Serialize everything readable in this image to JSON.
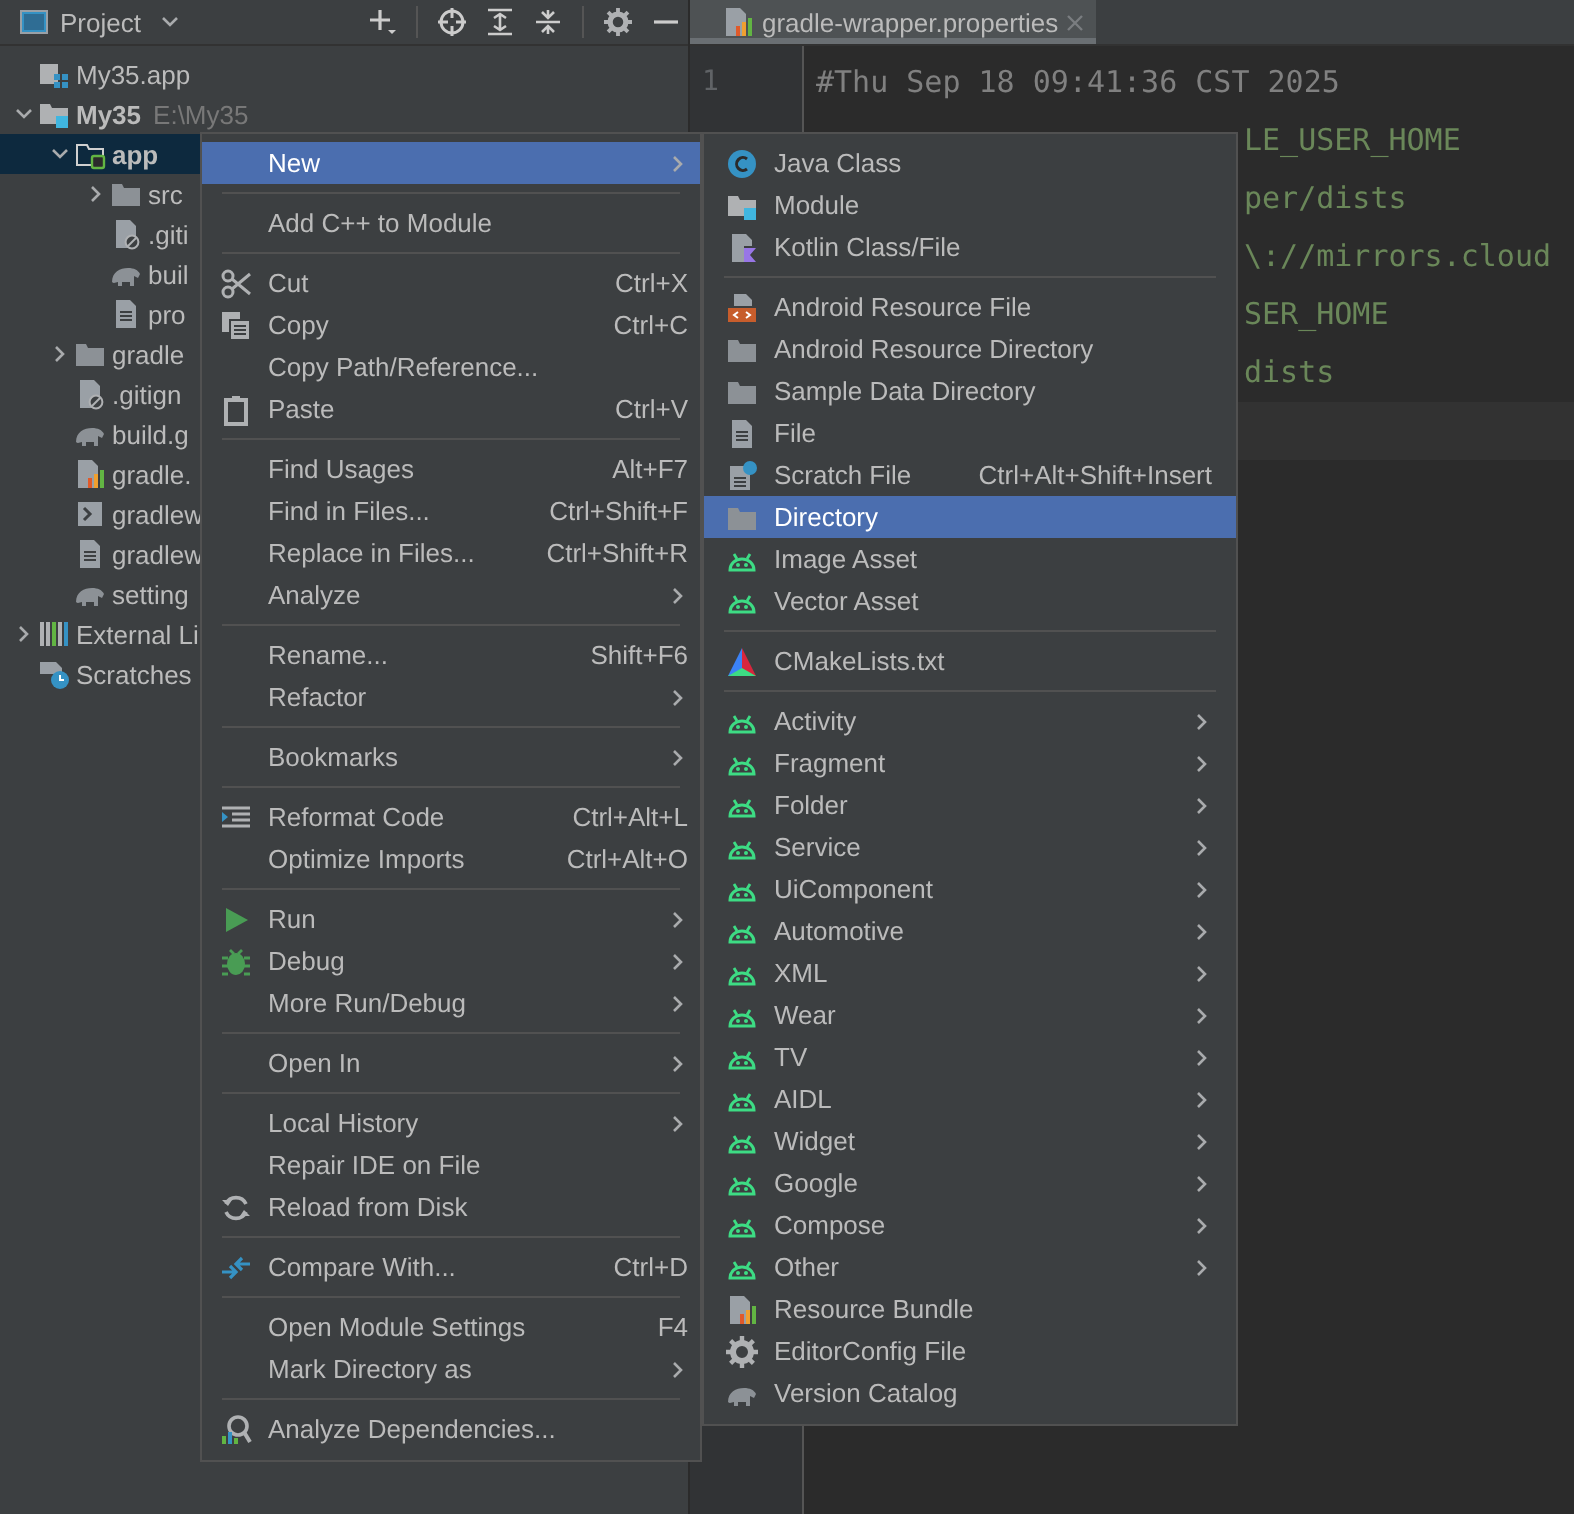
{
  "project_panel": {
    "title": "Project",
    "tree": [
      {
        "label": "My35.app",
        "kind": "module-app",
        "selected": false
      },
      {
        "label": "My35",
        "path": "E:\\My35",
        "kind": "module",
        "bold": true,
        "expanded": true,
        "selected": false,
        "children": [
          {
            "label": "app",
            "kind": "module-folder",
            "bold": true,
            "expanded": true,
            "selected": true,
            "children": [
              {
                "label": "src",
                "kind": "folder",
                "expanded": false,
                "selected": false
              },
              {
                "label": ".giti",
                "kind": "file-ignore",
                "selected": false
              },
              {
                "label": "buil",
                "kind": "elephant",
                "selected": false
              },
              {
                "label": "pro",
                "kind": "file",
                "selected": false
              }
            ]
          },
          {
            "label": "gradle",
            "kind": "folder",
            "expanded": false,
            "selected": false
          },
          {
            "label": ".gitign",
            "kind": "file-ignore",
            "selected": false
          },
          {
            "label": "build.g",
            "kind": "elephant",
            "selected": false
          },
          {
            "label": "gradle.",
            "kind": "bars",
            "selected": false
          },
          {
            "label": "gradlew",
            "kind": "terminal",
            "selected": false
          },
          {
            "label": "gradlew",
            "kind": "file",
            "selected": false
          },
          {
            "label": "setting",
            "kind": "elephant",
            "selected": false
          }
        ]
      },
      {
        "label": "External Li",
        "kind": "library",
        "expanded": false,
        "selected": false
      },
      {
        "label": "Scratches",
        "kind": "scratches",
        "selected": false
      }
    ]
  },
  "editor": {
    "tab": {
      "title": "gradle-wrapper.properties",
      "selected": true
    },
    "line_numbers": [
      "1"
    ],
    "lines": [
      {
        "text": "#Thu Sep 18 09:41:36 CST 2025",
        "kind": "comment"
      },
      {
        "text": "LE_USER_HOME",
        "kind": "clipped"
      },
      {
        "text": "per/dists",
        "kind": "clipped"
      },
      {
        "text": "\\://mirrors.cloud",
        "kind": "clipped"
      },
      {
        "text": "SER_HOME",
        "kind": "clipped"
      },
      {
        "text": "dists",
        "kind": "clipped"
      }
    ]
  },
  "context_menu": {
    "items": [
      {
        "kind": "plain",
        "label": "New",
        "submenu": true,
        "selected": true
      },
      {
        "kind": "separator"
      },
      {
        "kind": "plain",
        "label": "Add C++ to Module",
        "selected": false
      },
      {
        "kind": "separator"
      },
      {
        "kind": "scissors",
        "label": "Cut",
        "shortcut": "Ctrl+X",
        "selected": false
      },
      {
        "kind": "copy",
        "label": "Copy",
        "shortcut": "Ctrl+C",
        "selected": false
      },
      {
        "kind": "plain",
        "label": "Copy Path/Reference...",
        "selected": false
      },
      {
        "kind": "clipboard",
        "label": "Paste",
        "shortcut": "Ctrl+V",
        "selected": false
      },
      {
        "kind": "separator"
      },
      {
        "kind": "plain",
        "label": "Find Usages",
        "shortcut": "Alt+F7",
        "selected": false
      },
      {
        "kind": "plain",
        "label": "Find in Files...",
        "shortcut": "Ctrl+Shift+F",
        "selected": false
      },
      {
        "kind": "plain",
        "label": "Replace in Files...",
        "shortcut": "Ctrl+Shift+R",
        "selected": false
      },
      {
        "kind": "plain",
        "label": "Analyze",
        "submenu": true,
        "selected": false
      },
      {
        "kind": "separator"
      },
      {
        "kind": "plain",
        "label": "Rename...",
        "shortcut": "Shift+F6",
        "selected": false
      },
      {
        "kind": "plain",
        "label": "Refactor",
        "submenu": true,
        "selected": false
      },
      {
        "kind": "separator"
      },
      {
        "kind": "plain",
        "label": "Bookmarks",
        "submenu": true,
        "selected": false
      },
      {
        "kind": "separator"
      },
      {
        "kind": "reformat",
        "label": "Reformat Code",
        "shortcut": "Ctrl+Alt+L",
        "selected": false
      },
      {
        "kind": "plain",
        "label": "Optimize Imports",
        "shortcut": "Ctrl+Alt+O",
        "selected": false
      },
      {
        "kind": "separator"
      },
      {
        "kind": "play",
        "label": "Run",
        "submenu": true,
        "selected": false
      },
      {
        "kind": "bug",
        "label": "Debug",
        "submenu": true,
        "selected": false
      },
      {
        "kind": "plain",
        "label": "More Run/Debug",
        "submenu": true,
        "selected": false
      },
      {
        "kind": "separator"
      },
      {
        "kind": "plain",
        "label": "Open In",
        "submenu": true,
        "selected": false
      },
      {
        "kind": "separator"
      },
      {
        "kind": "plain",
        "label": "Local History",
        "submenu": true,
        "selected": false
      },
      {
        "kind": "plain",
        "label": "Repair IDE on File",
        "selected": false
      },
      {
        "kind": "reload",
        "label": "Reload from Disk",
        "selected": false
      },
      {
        "kind": "separator"
      },
      {
        "kind": "compare",
        "label": "Compare With...",
        "shortcut": "Ctrl+D",
        "selected": false
      },
      {
        "kind": "separator"
      },
      {
        "kind": "plain",
        "label": "Open Module Settings",
        "shortcut": "F4",
        "selected": false
      },
      {
        "kind": "plain",
        "label": "Mark Directory as",
        "submenu": true,
        "selected": false
      },
      {
        "kind": "separator"
      },
      {
        "kind": "analyze",
        "label": "Analyze Dependencies...",
        "selected": false
      }
    ]
  },
  "new_submenu": {
    "items": [
      {
        "kind": "java",
        "label": "Java Class",
        "selected": false
      },
      {
        "kind": "module",
        "label": "Module",
        "selected": false
      },
      {
        "kind": "kotlin",
        "label": "Kotlin Class/File",
        "selected": false
      },
      {
        "kind": "separator"
      },
      {
        "kind": "res-file",
        "label": "Android Resource File",
        "selected": false
      },
      {
        "kind": "folder",
        "label": "Android Resource Directory",
        "selected": false
      },
      {
        "kind": "folder",
        "label": "Sample Data Directory",
        "selected": false
      },
      {
        "kind": "file",
        "label": "File",
        "selected": false
      },
      {
        "kind": "scratch",
        "label": "Scratch File",
        "shortcut": "Ctrl+Alt+Shift+Insert",
        "selected": false
      },
      {
        "kind": "folder",
        "label": "Directory",
        "selected": true
      },
      {
        "kind": "android",
        "label": "Image Asset",
        "selected": false
      },
      {
        "kind": "android",
        "label": "Vector Asset",
        "selected": false
      },
      {
        "kind": "separator"
      },
      {
        "kind": "cmake",
        "label": "CMakeLists.txt",
        "selected": false
      },
      {
        "kind": "separator"
      },
      {
        "kind": "android",
        "label": "Activity",
        "submenu": true,
        "selected": false
      },
      {
        "kind": "android",
        "label": "Fragment",
        "submenu": true,
        "selected": false
      },
      {
        "kind": "android",
        "label": "Folder",
        "submenu": true,
        "selected": false
      },
      {
        "kind": "android",
        "label": "Service",
        "submenu": true,
        "selected": false
      },
      {
        "kind": "android",
        "label": "UiComponent",
        "submenu": true,
        "selected": false
      },
      {
        "kind": "android",
        "label": "Automotive",
        "submenu": true,
        "selected": false
      },
      {
        "kind": "android",
        "label": "XML",
        "submenu": true,
        "selected": false
      },
      {
        "kind": "android",
        "label": "Wear",
        "submenu": true,
        "selected": false
      },
      {
        "kind": "android",
        "label": "TV",
        "submenu": true,
        "selected": false
      },
      {
        "kind": "android",
        "label": "AIDL",
        "submenu": true,
        "selected": false
      },
      {
        "kind": "android",
        "label": "Widget",
        "submenu": true,
        "selected": false
      },
      {
        "kind": "android",
        "label": "Google",
        "submenu": true,
        "selected": false
      },
      {
        "kind": "android",
        "label": "Compose",
        "submenu": true,
        "selected": false
      },
      {
        "kind": "android",
        "label": "Other",
        "submenu": true,
        "selected": false
      },
      {
        "kind": "bars",
        "label": "Resource Bundle",
        "selected": false
      },
      {
        "kind": "gear",
        "label": "EditorConfig File",
        "selected": false
      },
      {
        "kind": "elephant",
        "label": "Version Catalog",
        "selected": false
      }
    ]
  }
}
